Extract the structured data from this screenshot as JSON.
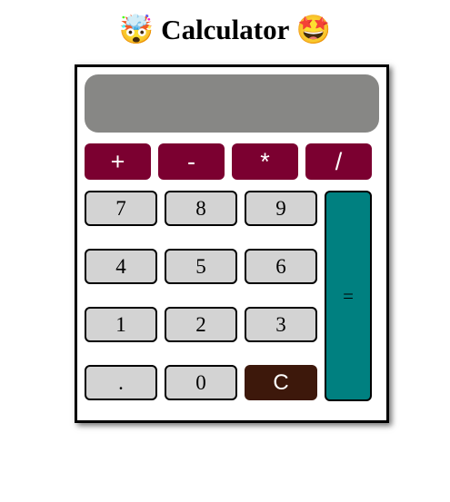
{
  "header": {
    "title": "🤯 Calculator 🤩"
  },
  "display": {
    "value": ""
  },
  "operators": {
    "add": "+",
    "subtract": "-",
    "multiply": "*",
    "divide": "/"
  },
  "keypad": {
    "seven": "7",
    "eight": "8",
    "nine": "9",
    "four": "4",
    "five": "5",
    "six": "6",
    "one": "1",
    "two": "2",
    "three": "3",
    "decimal": ".",
    "zero": "0",
    "clear": "C",
    "equals": "="
  },
  "colors": {
    "display_bg": "#878785",
    "operator_bg": "#7b0030",
    "number_bg": "#d3d3d3",
    "clear_bg": "#3d180b",
    "equals_bg": "#008080"
  }
}
